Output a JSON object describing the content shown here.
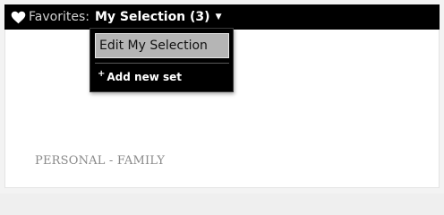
{
  "favorites_bar": {
    "label": "Favorites:",
    "selection": "My Selection (3)",
    "heart_icon": "heart-icon",
    "caret_icon": "caret-down-icon",
    "caret_glyph": "▼"
  },
  "dropdown": {
    "items": [
      {
        "label": "Edit My Selection",
        "highlighted": true
      },
      {
        "label": "Add new set",
        "icon": "plus-icon",
        "icon_glyph": "+"
      }
    ]
  },
  "content": {
    "section_title": "PERSONAL - FAMILY"
  },
  "colors": {
    "bar_background": "#000000",
    "highlight": "#b5b5b5",
    "section_title": "#8a8a8a"
  }
}
